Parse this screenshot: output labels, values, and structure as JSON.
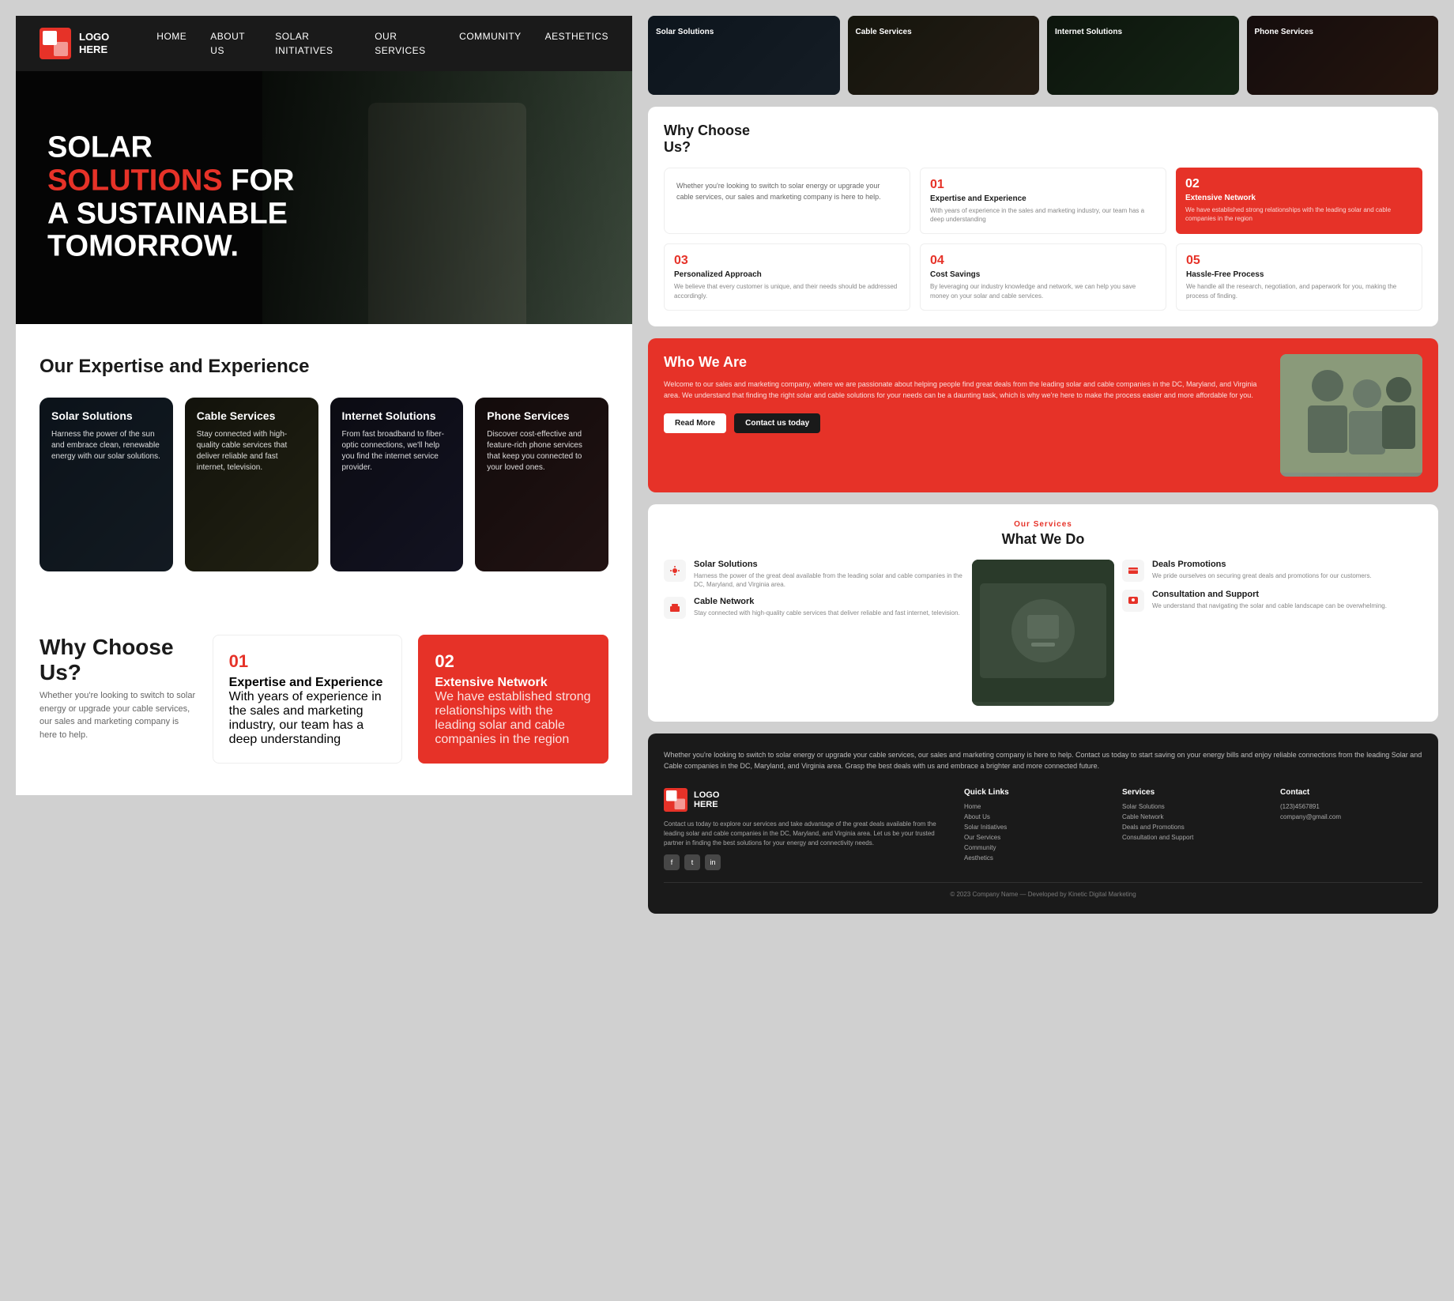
{
  "nav": {
    "logo_line1": "LOGO",
    "logo_line2": "HERE",
    "links": [
      "HOME",
      "ABOUT US",
      "SOLAR INITIATIVES",
      "OUR SERVICES",
      "COMMUNITY",
      "AESTHETICS"
    ]
  },
  "hero": {
    "line1": "SOLAR",
    "line2_red": "SOLUTIONS",
    "line2_rest": " FOR",
    "line3": "A SUSTAINABLE",
    "line4": "TOMORROW."
  },
  "expertise": {
    "title": "Our Expertise and Experience",
    "cards": [
      {
        "title": "Solar Solutions",
        "desc": "Harness the power of the sun and embrace clean, renewable energy with our solar solutions."
      },
      {
        "title": "Cable Services",
        "desc": "Stay connected with high-quality cable services that deliver reliable and fast internet, television."
      },
      {
        "title": "Internet Solutions",
        "desc": "From fast broadband to fiber-optic connections, we'll help you find the internet service provider."
      },
      {
        "title": "Phone Services",
        "desc": "Discover cost-effective and feature-rich phone services that keep you connected to your loved ones."
      }
    ]
  },
  "why_choose": {
    "title": "Why Choose Us?",
    "subtitle": "Whether you're looking to switch to solar energy or upgrade your cable services, our sales and marketing company is here to help.",
    "items": [
      {
        "num": "01",
        "title": "Expertise and Experience",
        "desc": "With years of experience in the sales and marketing industry, our team has a deep understanding"
      },
      {
        "num": "02",
        "title": "Extensive Network",
        "desc": "We have established strong relationships with the leading solar and cable companies in the region",
        "highlighted": true
      },
      {
        "num": "03",
        "title": "Personalized Approach",
        "desc": "We believe that every customer is unique, and their needs should be addressed accordingly."
      },
      {
        "num": "04",
        "title": "Cost Savings",
        "desc": "By leveraging our industry knowledge and network, we can help you save money on your solar and cable services."
      },
      {
        "num": "05",
        "title": "Hassle-Free Process",
        "desc": "We handle all the research, negotiation, and paperwork for you, making the process of finding."
      }
    ]
  },
  "who_we_are": {
    "title": "Who We Are",
    "desc": "Welcome to our sales and marketing company, where we are passionate about helping people find great deals from the leading solar and cable companies in the DC, Maryland, and Virginia area. We understand that finding the right solar and cable solutions for your needs can be a daunting task, which is why we're here to make the process easier and more affordable for you.",
    "btn1": "Read More",
    "btn2": "Contact us today"
  },
  "what_we_do": {
    "label": "Our Services",
    "title": "What We Do",
    "items_left": [
      {
        "title": "Solar Solutions",
        "desc": "Harness the power of the great deal available from the leading solar and cable companies in the DC, Maryland, and Virginia area."
      },
      {
        "title": "Cable Network",
        "desc": "Stay connected with high-quality cable services that deliver reliable and fast internet, television."
      }
    ],
    "items_right": [
      {
        "title": "Deals Promotions",
        "desc": "We pride ourselves on securing great deals and promotions for our customers."
      },
      {
        "title": "Consultation and Support",
        "desc": "We understand that navigating the solar and cable landscape can be overwhelming."
      }
    ]
  },
  "footer": {
    "top_text": "Whether you're looking to switch to solar energy or upgrade your cable services, our sales and marketing company is here to help. Contact us today to start saving on your energy bills and enjoy reliable connections from the leading Solar and Cable companies in the DC, Maryland, and Virginia area. Grasp the best deals with us and embrace a brighter and more connected future.",
    "logo_line1": "LOGO",
    "logo_line2": "HERE",
    "logo_desc": "Contact us today to explore our services and take advantage of the great deals available from the leading solar and cable companies in the DC, Maryland, and Virginia area. Let us be your trusted partner in finding the best solutions for your energy and connectivity needs.",
    "quick_links": {
      "title": "Quick Links",
      "items": [
        "Home",
        "About Us",
        "Solar Initiatives",
        "Our Services",
        "Community",
        "Aesthetics"
      ]
    },
    "services": {
      "title": "Services",
      "items": [
        "Solar Solutions",
        "Cable Network",
        "Deals and Promotions",
        "Consultation and Support"
      ]
    },
    "contact": {
      "title": "Contact",
      "items": [
        "(123)4567891",
        "company@gmail.com"
      ]
    },
    "copyright": "© 2023 Company Name — Developed by Kinetic Digital Marketing"
  },
  "mini_cards": [
    {
      "title": "Solar Solutions"
    },
    {
      "title": "Cable Services"
    },
    {
      "title": "Internet Solutions"
    },
    {
      "title": "Phone Services"
    }
  ]
}
